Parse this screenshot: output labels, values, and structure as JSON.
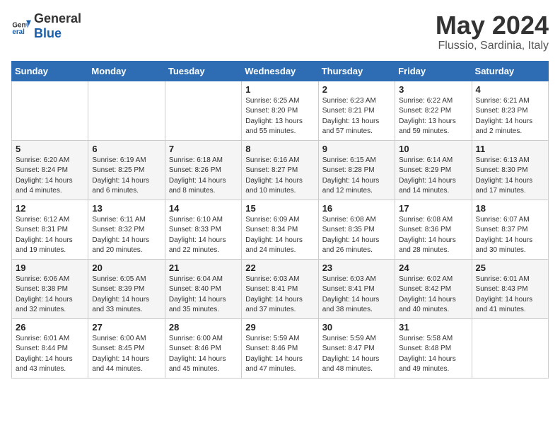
{
  "header": {
    "logo_general": "General",
    "logo_blue": "Blue",
    "title": "May 2024",
    "subtitle": "Flussio, Sardinia, Italy"
  },
  "calendar": {
    "days_of_week": [
      "Sunday",
      "Monday",
      "Tuesday",
      "Wednesday",
      "Thursday",
      "Friday",
      "Saturday"
    ],
    "weeks": [
      [
        {
          "day": "",
          "sunrise": "",
          "sunset": "",
          "daylight": ""
        },
        {
          "day": "",
          "sunrise": "",
          "sunset": "",
          "daylight": ""
        },
        {
          "day": "",
          "sunrise": "",
          "sunset": "",
          "daylight": ""
        },
        {
          "day": "1",
          "sunrise": "Sunrise: 6:25 AM",
          "sunset": "Sunset: 8:20 PM",
          "daylight": "Daylight: 13 hours and 55 minutes."
        },
        {
          "day": "2",
          "sunrise": "Sunrise: 6:23 AM",
          "sunset": "Sunset: 8:21 PM",
          "daylight": "Daylight: 13 hours and 57 minutes."
        },
        {
          "day": "3",
          "sunrise": "Sunrise: 6:22 AM",
          "sunset": "Sunset: 8:22 PM",
          "daylight": "Daylight: 13 hours and 59 minutes."
        },
        {
          "day": "4",
          "sunrise": "Sunrise: 6:21 AM",
          "sunset": "Sunset: 8:23 PM",
          "daylight": "Daylight: 14 hours and 2 minutes."
        }
      ],
      [
        {
          "day": "5",
          "sunrise": "Sunrise: 6:20 AM",
          "sunset": "Sunset: 8:24 PM",
          "daylight": "Daylight: 14 hours and 4 minutes."
        },
        {
          "day": "6",
          "sunrise": "Sunrise: 6:19 AM",
          "sunset": "Sunset: 8:25 PM",
          "daylight": "Daylight: 14 hours and 6 minutes."
        },
        {
          "day": "7",
          "sunrise": "Sunrise: 6:18 AM",
          "sunset": "Sunset: 8:26 PM",
          "daylight": "Daylight: 14 hours and 8 minutes."
        },
        {
          "day": "8",
          "sunrise": "Sunrise: 6:16 AM",
          "sunset": "Sunset: 8:27 PM",
          "daylight": "Daylight: 14 hours and 10 minutes."
        },
        {
          "day": "9",
          "sunrise": "Sunrise: 6:15 AM",
          "sunset": "Sunset: 8:28 PM",
          "daylight": "Daylight: 14 hours and 12 minutes."
        },
        {
          "day": "10",
          "sunrise": "Sunrise: 6:14 AM",
          "sunset": "Sunset: 8:29 PM",
          "daylight": "Daylight: 14 hours and 14 minutes."
        },
        {
          "day": "11",
          "sunrise": "Sunrise: 6:13 AM",
          "sunset": "Sunset: 8:30 PM",
          "daylight": "Daylight: 14 hours and 17 minutes."
        }
      ],
      [
        {
          "day": "12",
          "sunrise": "Sunrise: 6:12 AM",
          "sunset": "Sunset: 8:31 PM",
          "daylight": "Daylight: 14 hours and 19 minutes."
        },
        {
          "day": "13",
          "sunrise": "Sunrise: 6:11 AM",
          "sunset": "Sunset: 8:32 PM",
          "daylight": "Daylight: 14 hours and 20 minutes."
        },
        {
          "day": "14",
          "sunrise": "Sunrise: 6:10 AM",
          "sunset": "Sunset: 8:33 PM",
          "daylight": "Daylight: 14 hours and 22 minutes."
        },
        {
          "day": "15",
          "sunrise": "Sunrise: 6:09 AM",
          "sunset": "Sunset: 8:34 PM",
          "daylight": "Daylight: 14 hours and 24 minutes."
        },
        {
          "day": "16",
          "sunrise": "Sunrise: 6:08 AM",
          "sunset": "Sunset: 8:35 PM",
          "daylight": "Daylight: 14 hours and 26 minutes."
        },
        {
          "day": "17",
          "sunrise": "Sunrise: 6:08 AM",
          "sunset": "Sunset: 8:36 PM",
          "daylight": "Daylight: 14 hours and 28 minutes."
        },
        {
          "day": "18",
          "sunrise": "Sunrise: 6:07 AM",
          "sunset": "Sunset: 8:37 PM",
          "daylight": "Daylight: 14 hours and 30 minutes."
        }
      ],
      [
        {
          "day": "19",
          "sunrise": "Sunrise: 6:06 AM",
          "sunset": "Sunset: 8:38 PM",
          "daylight": "Daylight: 14 hours and 32 minutes."
        },
        {
          "day": "20",
          "sunrise": "Sunrise: 6:05 AM",
          "sunset": "Sunset: 8:39 PM",
          "daylight": "Daylight: 14 hours and 33 minutes."
        },
        {
          "day": "21",
          "sunrise": "Sunrise: 6:04 AM",
          "sunset": "Sunset: 8:40 PM",
          "daylight": "Daylight: 14 hours and 35 minutes."
        },
        {
          "day": "22",
          "sunrise": "Sunrise: 6:03 AM",
          "sunset": "Sunset: 8:41 PM",
          "daylight": "Daylight: 14 hours and 37 minutes."
        },
        {
          "day": "23",
          "sunrise": "Sunrise: 6:03 AM",
          "sunset": "Sunset: 8:41 PM",
          "daylight": "Daylight: 14 hours and 38 minutes."
        },
        {
          "day": "24",
          "sunrise": "Sunrise: 6:02 AM",
          "sunset": "Sunset: 8:42 PM",
          "daylight": "Daylight: 14 hours and 40 minutes."
        },
        {
          "day": "25",
          "sunrise": "Sunrise: 6:01 AM",
          "sunset": "Sunset: 8:43 PM",
          "daylight": "Daylight: 14 hours and 41 minutes."
        }
      ],
      [
        {
          "day": "26",
          "sunrise": "Sunrise: 6:01 AM",
          "sunset": "Sunset: 8:44 PM",
          "daylight": "Daylight: 14 hours and 43 minutes."
        },
        {
          "day": "27",
          "sunrise": "Sunrise: 6:00 AM",
          "sunset": "Sunset: 8:45 PM",
          "daylight": "Daylight: 14 hours and 44 minutes."
        },
        {
          "day": "28",
          "sunrise": "Sunrise: 6:00 AM",
          "sunset": "Sunset: 8:46 PM",
          "daylight": "Daylight: 14 hours and 45 minutes."
        },
        {
          "day": "29",
          "sunrise": "Sunrise: 5:59 AM",
          "sunset": "Sunset: 8:46 PM",
          "daylight": "Daylight: 14 hours and 47 minutes."
        },
        {
          "day": "30",
          "sunrise": "Sunrise: 5:59 AM",
          "sunset": "Sunset: 8:47 PM",
          "daylight": "Daylight: 14 hours and 48 minutes."
        },
        {
          "day": "31",
          "sunrise": "Sunrise: 5:58 AM",
          "sunset": "Sunset: 8:48 PM",
          "daylight": "Daylight: 14 hours and 49 minutes."
        },
        {
          "day": "",
          "sunrise": "",
          "sunset": "",
          "daylight": ""
        }
      ]
    ]
  }
}
